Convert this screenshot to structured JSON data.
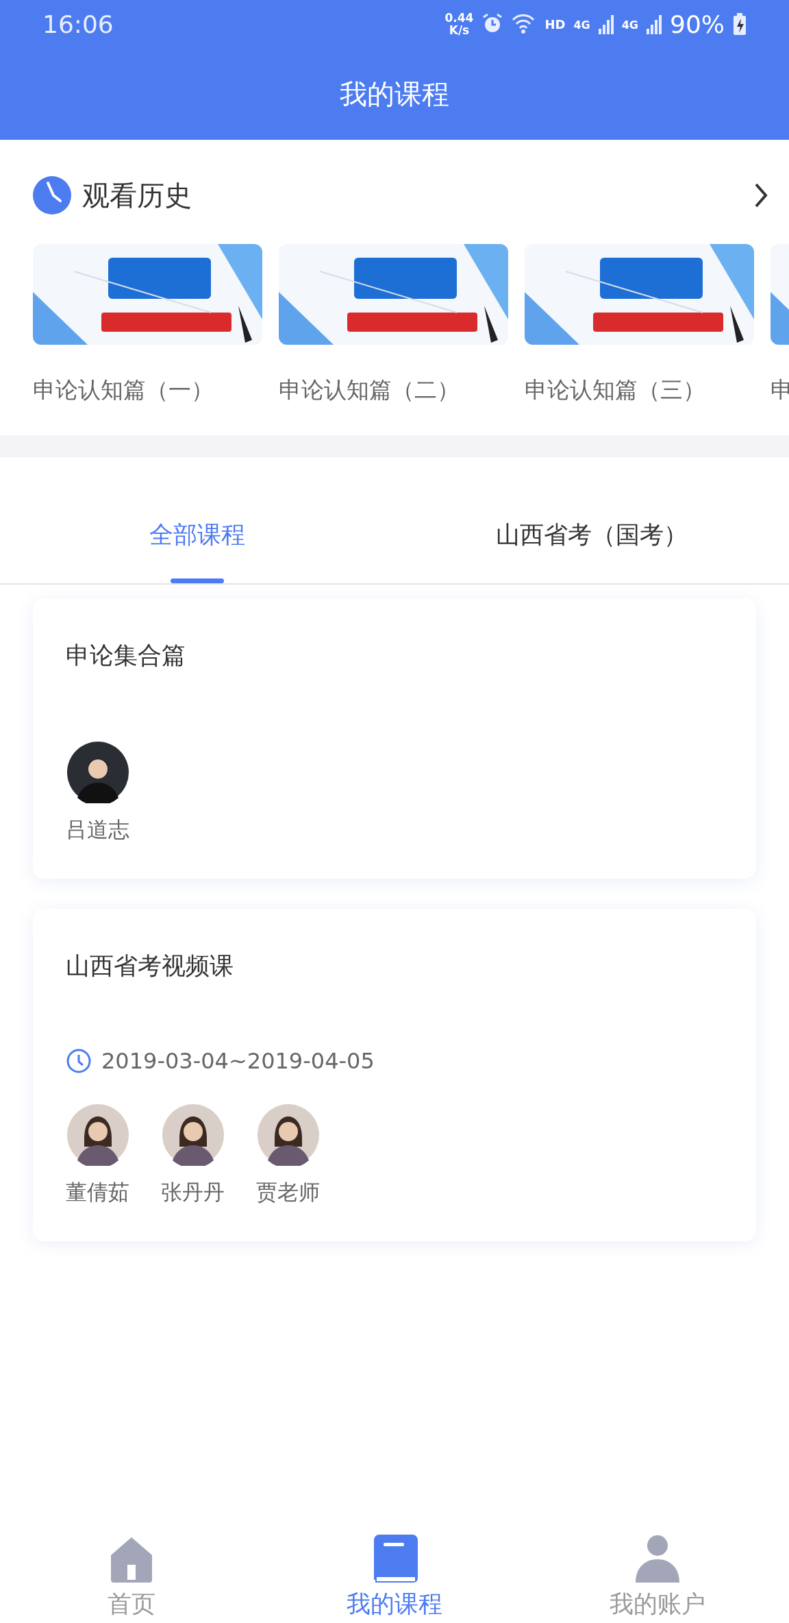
{
  "status_bar": {
    "time": "16:06",
    "speed_value": "0.44",
    "speed_unit": "K/s",
    "hd": "HD",
    "networks": [
      "4G",
      "4G"
    ],
    "battery": "90%"
  },
  "header": {
    "title": "我的课程"
  },
  "history": {
    "title": "观看历史",
    "items": [
      {
        "title": "申论认知篇（一）"
      },
      {
        "title": "申论认知篇（二）"
      },
      {
        "title": "申论认知篇（三）"
      },
      {
        "title": "申"
      }
    ]
  },
  "tabs": [
    {
      "label": "全部课程",
      "selected": true
    },
    {
      "label": "山西省考（国考）",
      "selected": false
    }
  ],
  "courses": [
    {
      "title": "申论集合篇",
      "teachers": [
        {
          "name": "吕道志",
          "kind": "male"
        }
      ]
    },
    {
      "title": "山西省考视频课",
      "date": "2019-03-04~2019-04-05",
      "teachers": [
        {
          "name": "董倩茹",
          "kind": "female"
        },
        {
          "name": "张丹丹",
          "kind": "female"
        },
        {
          "name": "贾老师",
          "kind": "female"
        }
      ]
    }
  ],
  "bottom_nav": [
    {
      "label": "首页",
      "kind": "home",
      "selected": false
    },
    {
      "label": "我的课程",
      "kind": "book",
      "selected": true
    },
    {
      "label": "我的账户",
      "kind": "person",
      "selected": false
    }
  ]
}
